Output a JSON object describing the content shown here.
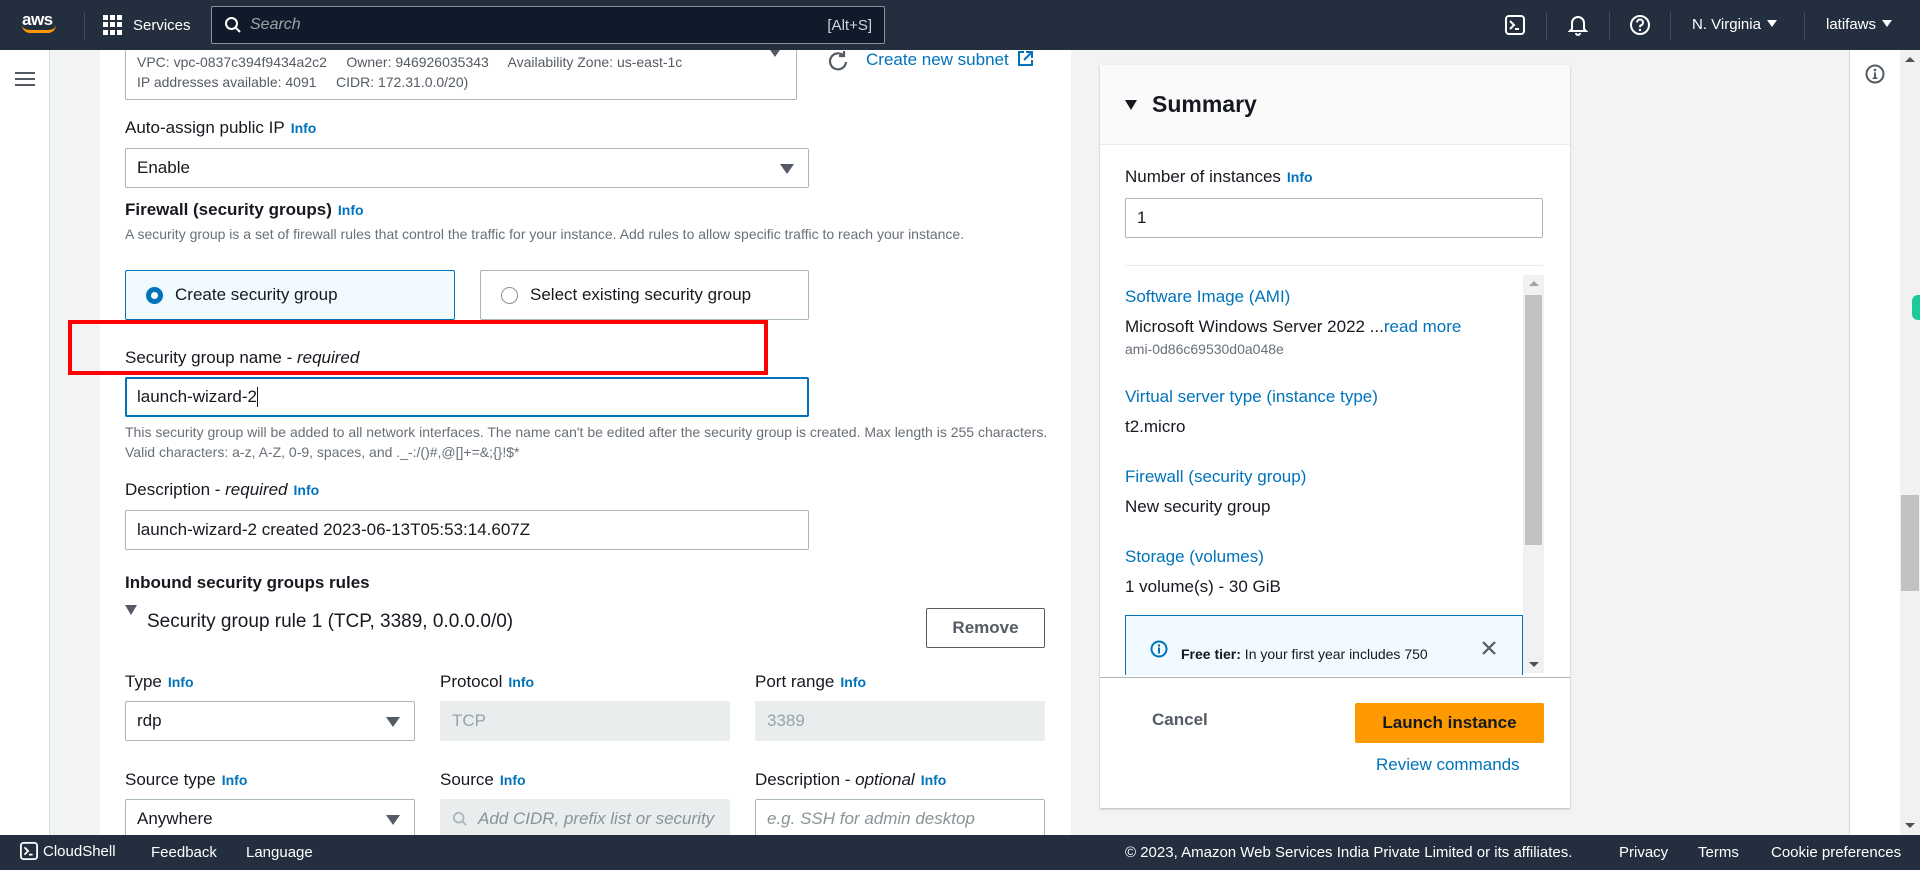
{
  "header": {
    "logo_text": "aws",
    "services_label": "Services",
    "search_placeholder": "Search",
    "search_shortcut": "[Alt+S]",
    "region_label": "N. Virginia",
    "account_label": "latifaws",
    "icons": [
      "cloudshell-icon",
      "notifications-bell-icon",
      "help-icon"
    ]
  },
  "form": {
    "subnet": {
      "line1": "VPC: vpc-0837c394f9434a2c2     Owner: 946926035343     Availability Zone: us-east-1c",
      "line2": "IP addresses available: 4091     CIDR: 172.31.0.0/20)",
      "create_new_subnet_link": "Create new subnet"
    },
    "auto_assign_ip": {
      "label": "Auto-assign public IP",
      "info": "Info",
      "value": "Enable"
    },
    "firewall": {
      "label": "Firewall (security groups)",
      "info": "Info",
      "description": "A security group is a set of firewall rules that control the traffic for your instance. Add rules to allow specific traffic to reach your instance.",
      "options": [
        {
          "label": "Create security group",
          "selected": true
        },
        {
          "label": "Select existing security group",
          "selected": false
        }
      ]
    },
    "sg_name": {
      "label": "Security group name - ",
      "required": "required",
      "value": "launch-wizard-2",
      "hint": "This security group will be added to all network interfaces. The name can't be edited after the security group is created. Max length is 255 characters. Valid characters: a-z, A-Z, 0-9, spaces, and ._-:/()#,@[]+=&;{}!$*"
    },
    "sg_description": {
      "label": "Description - ",
      "required": "required",
      "info": "Info",
      "value": "launch-wizard-2 created 2023-06-13T05:53:14.607Z"
    },
    "inbound": {
      "heading": "Inbound security groups rules",
      "rule_title": "Security group rule 1 (TCP, 3389, 0.0.0.0/0)",
      "remove_label": "Remove",
      "type_label": "Type",
      "type_value": "rdp",
      "protocol_label": "Protocol",
      "protocol_value": "TCP",
      "port_label": "Port range",
      "port_value": "3389",
      "source_type_label": "Source type",
      "source_type_value": "Anywhere",
      "source_label": "Source",
      "source_placeholder": "Add CIDR, prefix list or security",
      "desc_label": "Description - ",
      "desc_optional": "optional",
      "desc_placeholder": "e.g. SSH for admin desktop",
      "info": "Info"
    }
  },
  "summary": {
    "title": "Summary",
    "num_instances_label": "Number of instances",
    "info": "Info",
    "num_instances_value": "1",
    "items": [
      {
        "title": "Software Image (AMI)",
        "value": "Microsoft Windows Server 2022 ...",
        "link": "read more",
        "sub": "ami-0d86c69530d0a048e"
      },
      {
        "title": "Virtual server type (instance type)",
        "value": "t2.micro"
      },
      {
        "title": "Firewall (security group)",
        "value": "New security group"
      },
      {
        "title": "Storage (volumes)",
        "value": "1 volume(s) - 30 GiB"
      }
    ],
    "free_tier_bold": "Free tier:",
    "free_tier_text": " In your first year includes 750",
    "cancel_label": "Cancel",
    "launch_label": "Launch instance",
    "review_label": "Review commands"
  },
  "footer": {
    "cloudshell": "CloudShell",
    "feedback": "Feedback",
    "language": "Language",
    "copyright": "© 2023, Amazon Web Services India Private Limited or its affiliates.",
    "privacy": "Privacy",
    "terms": "Terms",
    "cookies": "Cookie preferences"
  },
  "colors": {
    "header_bg": "#232f3e",
    "link": "#0073bb",
    "primary_button": "#ff9900",
    "highlight_box": "#ff0000"
  }
}
